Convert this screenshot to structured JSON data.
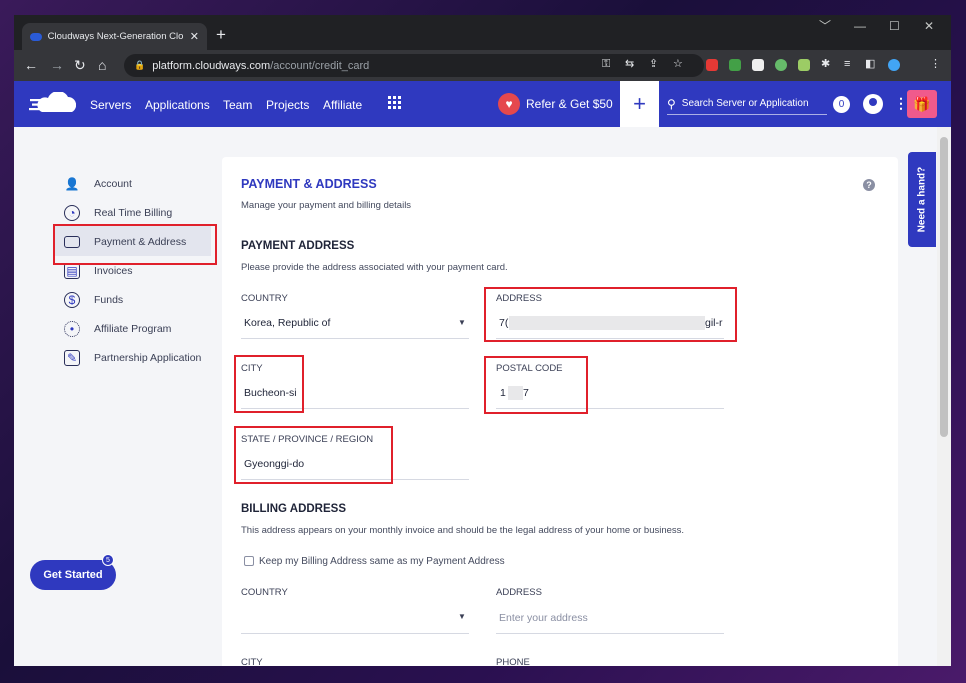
{
  "browser": {
    "tab_title": "Cloudways Next-Generation Clo",
    "tab_close": "✕",
    "new_tab": "+",
    "url_host": "platform.cloudways.com",
    "url_path": "/account/credit_card",
    "window_controls": [
      "﹀",
      "—",
      "☐",
      "✕"
    ]
  },
  "header": {
    "nav": [
      "Servers",
      "Applications",
      "Team",
      "Projects",
      "Affiliate"
    ],
    "refer_label": "Refer & Get $50",
    "add_label": "+",
    "search_placeholder": "Search Server or Application",
    "notification_count": "0",
    "accent": "#2f39bf"
  },
  "sidebar": {
    "items": [
      {
        "label": "Account",
        "icon": "user-icon"
      },
      {
        "label": "Real Time Billing",
        "icon": "clock-icon"
      },
      {
        "label": "Payment & Address",
        "icon": "credit-card-icon"
      },
      {
        "label": "Invoices",
        "icon": "invoice-icon"
      },
      {
        "label": "Funds",
        "icon": "dollar-icon"
      },
      {
        "label": "Affiliate Program",
        "icon": "affiliate-icon"
      },
      {
        "label": "Partnership Application",
        "icon": "partnership-icon"
      }
    ],
    "active": "Payment & Address"
  },
  "get_started": {
    "label": "Get Started",
    "badge": "5"
  },
  "need_hand": "Need a hand?",
  "main": {
    "title": "PAYMENT & ADDRESS",
    "subtitle": "Manage your payment and billing details",
    "payment_address": {
      "heading": "PAYMENT ADDRESS",
      "description": "Please provide the address associated with your payment card.",
      "country_label": "COUNTRY",
      "country_value": "Korea, Republic of",
      "address_label": "ADDRESS",
      "address_value_start": "7(",
      "address_value_end": "gil-r",
      "city_label": "CITY",
      "city_value": "Bucheon-si",
      "postal_label": "POSTAL CODE",
      "postal_value_start": "1",
      "postal_value_end": "7",
      "state_label": "STATE / PROVINCE / REGION",
      "state_value": "Gyeonggi-do"
    },
    "billing_address": {
      "heading": "BILLING ADDRESS",
      "description": "This address appears on your monthly invoice and should be the legal address of your home or business.",
      "same_checkbox_label": "Keep my Billing Address same as my Payment Address",
      "country_label": "COUNTRY",
      "address_label": "ADDRESS",
      "address_placeholder": "Enter your address",
      "city_label": "CITY",
      "phone_label": "PHONE"
    }
  },
  "colors": {
    "highlight": "#e0202b",
    "brand": "#2f39bf"
  }
}
